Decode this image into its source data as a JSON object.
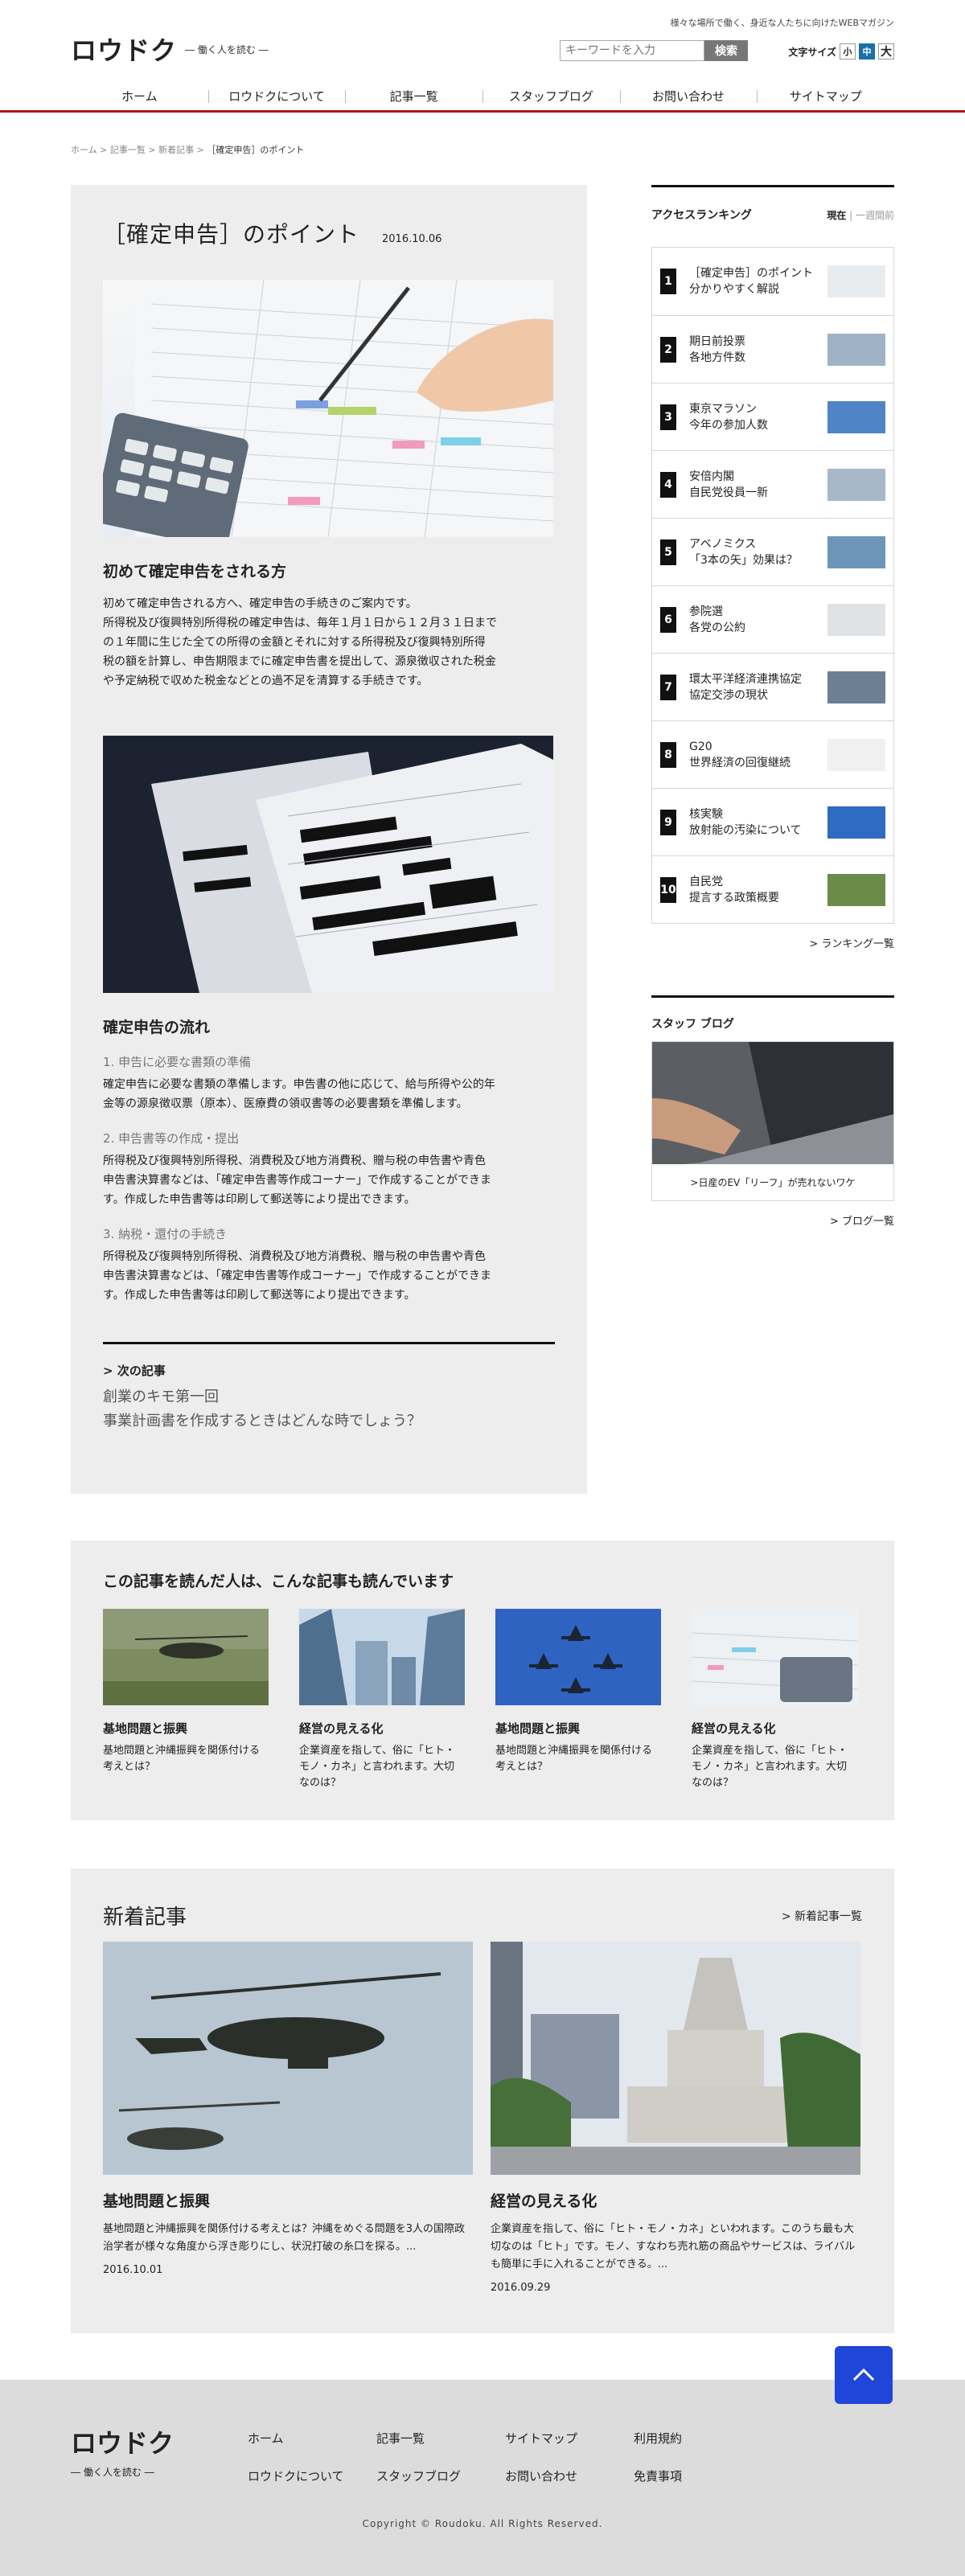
{
  "header": {
    "logo": "ロウドク",
    "logo_sub": "― 働く人を読む ―",
    "tagline": "様々な場所で働く、身近な人たちに向けたWEBマガジン",
    "search_placeholder": "キーワードを入力",
    "search_button": "検索",
    "fontsize_label": "文字サイズ",
    "fontsize_small": "小",
    "fontsize_medium": "中",
    "fontsize_large": "大"
  },
  "nav": [
    "ホーム",
    "ロウドクについて",
    "記事一覧",
    "スタッフブログ",
    "お問い合わせ",
    "サイトマップ"
  ],
  "breadcrumb": {
    "items": [
      "ホーム",
      "記事一覧",
      "新着記事"
    ],
    "current": "［確定申告］のポイント",
    "separator": ">"
  },
  "article": {
    "title": "［確定申告］のポイント",
    "date": "2016.10.06",
    "section1_title": "初めて確定申告をされる方",
    "section1_lines": [
      "初めて確定申告される方へ、確定申告の手続きのご案内です。",
      "所得税及び復興特別所得税の確定申告は、毎年１月１日から１２月３１日まで",
      "の１年間に生じた全ての所得の金額とそれに対する所得税及び復興特別所得",
      "税の額を計算し、申告期限までに確定申告書を提出して、源泉徴収された税金",
      "や予定納税で収めた税金などとの過不足を清算する手続きです。"
    ],
    "section2_title": "確定申告の流れ",
    "steps": [
      {
        "title": "1. 申告に必要な書類の準備",
        "lines": [
          "確定申告に必要な書類の準備します。申告書の他に応じて、給与所得や公的年",
          "金等の源泉徴収票（原本）、医療費の領収書等の必要書類を準備します。"
        ]
      },
      {
        "title": "2. 申告書等の作成・提出",
        "lines": [
          "所得税及び復興特別所得税、消費税及び地方消費税、贈与税の申告書や青色",
          "申告書決算書などは、「確定申告書等作成コーナー」で作成することができま",
          "す。作成した申告書等は印刷して郵送等により提出できます。"
        ]
      },
      {
        "title": "3. 納税・還付の手続き",
        "lines": [
          "所得税及び復興特別所得税、消費税及び地方消費税、贈与税の申告書や青色",
          "申告書決算書などは、「確定申告書等作成コーナー」で作成することができま",
          "す。作成した申告書等は印刷して郵送等により提出できます。"
        ]
      }
    ],
    "next_label": "次の記事",
    "next_title_line1": "創業のキモ第一回",
    "next_title_line2": "事業計画書を作成するときはどんな時でしょう？"
  },
  "ranking": {
    "title": "アクセスランキング",
    "tab_current": "現在",
    "tab_week": "一週間前",
    "tab_sep": "|",
    "items": [
      {
        "num": "1",
        "line1": "［確定申告］のポイント",
        "line2": "分かりやすく解説",
        "thumb": "#e9ecef"
      },
      {
        "num": "2",
        "line1": "期日前投票",
        "line2": "各地方件数",
        "thumb": "#9fb3c6"
      },
      {
        "num": "3",
        "line1": "東京マラソン",
        "line2": "今年の参加人数",
        "thumb": "#4f84c6"
      },
      {
        "num": "4",
        "line1": "安倍内閣",
        "line2": "自民党役員一新",
        "thumb": "#a8b8c8"
      },
      {
        "num": "5",
        "line1": "アベノミクス",
        "line2": "「3本の矢」効果は？",
        "thumb": "#6c95b8"
      },
      {
        "num": "6",
        "line1": "参院選",
        "line2": "各党の公約",
        "thumb": "#dfe3e6"
      },
      {
        "num": "7",
        "line1": "環太平洋経済連携協定",
        "line2": "協定交渉の現状",
        "thumb": "#6c7f93"
      },
      {
        "num": "8",
        "line1": "G20",
        "line2": "世界経済の回復継続",
        "thumb": "#f0f0f0"
      },
      {
        "num": "9",
        "line1": "核実験",
        "line2": "放射能の汚染について",
        "thumb": "#2f6bc0"
      },
      {
        "num": "10",
        "line1": "自民党",
        "line2": "提言する政策概要",
        "thumb": "#6b8b4a"
      }
    ],
    "more": "ランキング一覧"
  },
  "blog": {
    "title": "スタッフ ブログ",
    "caption": ">日産のEV「リーフ」が売れないワケ",
    "more": "ブログ一覧"
  },
  "related": {
    "title": "この記事を読んだ人は、こんな記事も読んでいます",
    "items": [
      {
        "title": "基地問題と振興",
        "desc": "基地問題と沖縄振興を関係付ける考えとは？",
        "img": "helicopter-field"
      },
      {
        "title": "経営の見える化",
        "desc": "企業資産を指して、俗に「ヒト・モノ・カネ」と言われます。大切なのは？",
        "img": "skyscrapers"
      },
      {
        "title": "基地問題と振興",
        "desc": "基地問題と沖縄振興を関係付ける考えとは？",
        "img": "jets-formation"
      },
      {
        "title": "経営の見える化",
        "desc": "企業資産を指して、俗に「ヒト・モノ・カネ」と言われます。大切なのは？",
        "img": "calculator-form"
      }
    ]
  },
  "new_articles": {
    "title": "新着記事",
    "more": "新着記事一覧",
    "items": [
      {
        "title": "基地問題と振興",
        "desc": "基地問題と沖縄振興を関係付ける考えとは？沖縄をめぐる問題を3人の国際政治学者が様々な角度から浮き彫りにし、状況打破の糸口を探る。...",
        "date": "2016.10.01"
      },
      {
        "title": "経営の見える化",
        "desc": "企業資産を指して、俗に「ヒト・モノ・カネ」といわれます。このうち最も大切なのは「ヒト」です。モノ、すなわち売れ筋の商品やサービスは、ライバルも簡単に手に入れることができる。...",
        "date": "2016.09.29"
      }
    ]
  },
  "footer": {
    "logo": "ロウドク",
    "logo_sub": "― 働く人を読む ―",
    "links": [
      "ホーム",
      "記事一覧",
      "サイトマップ",
      "利用規約",
      "ロウドクについて",
      "スタッフブログ",
      "お問い合わせ",
      "免責事項"
    ],
    "copyright": "Copyright © Roudoku. All Rights Reserved."
  },
  "colors": {
    "accent_red": "#b0141e",
    "pagetop_blue": "#1f46d8",
    "panel_gray": "#ededed",
    "footer_gray": "#dcdcdc"
  }
}
